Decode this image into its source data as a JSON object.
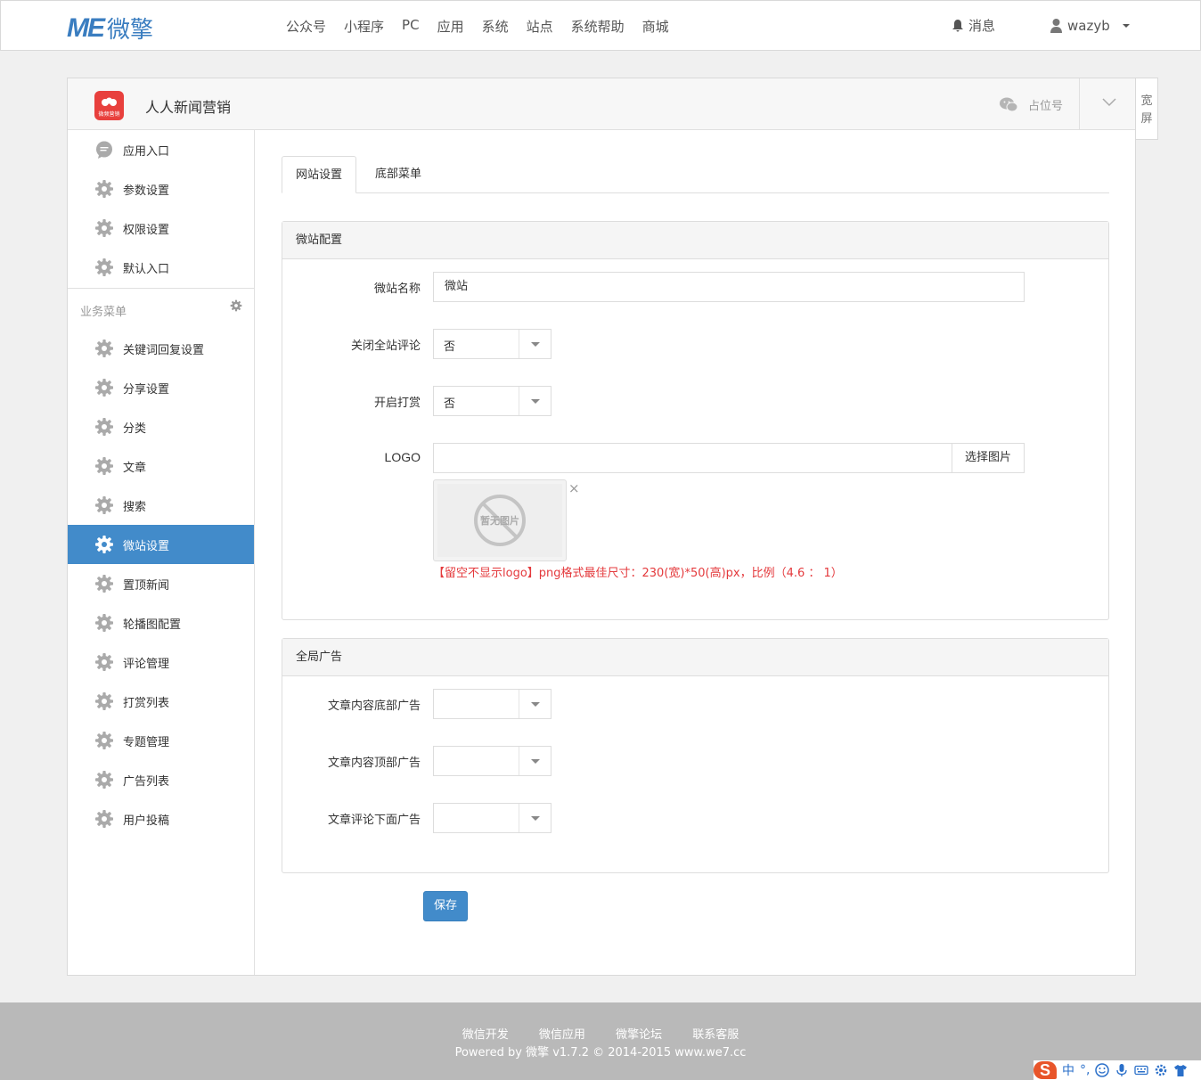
{
  "brand": {
    "logo_mark": "ME",
    "logo_text": "微擎"
  },
  "nav": [
    "公众号",
    "小程序",
    "PC",
    "应用",
    "系统",
    "站点",
    "系统帮助",
    "商城"
  ],
  "top_right": {
    "messages": "消息",
    "username": "wazyb"
  },
  "app": {
    "title": "人人新闻营销",
    "icon_text": "微频营销",
    "placeholder_account": "占位号",
    "accent": "#e8403d"
  },
  "wide_screen": {
    "line1": "宽",
    "line2": "屏"
  },
  "sidebar": {
    "top_items": [
      "应用入口",
      "参数设置",
      "权限设置",
      "默认入口"
    ],
    "group_label": "业务菜单",
    "items": [
      "关键词回复设置",
      "分享设置",
      "分类",
      "文章",
      "搜索",
      "微站设置",
      "置顶新闻",
      "轮播图配置",
      "评论管理",
      "打赏列表",
      "专题管理",
      "广告列表",
      "用户投稿"
    ],
    "active": "微站设置",
    "active_color": "#428bca"
  },
  "tabs": [
    "网站设置",
    "底部菜单"
  ],
  "site_config": {
    "title": "微站配置",
    "name_label": "微站名称",
    "name_value": "微站",
    "close_comments_label": "关闭全站评论",
    "close_comments_value": "否",
    "reward_label": "开启打赏",
    "reward_value": "否",
    "logo_label": "LOGO",
    "logo_value": "",
    "pick_image": "选择图片",
    "no_image": "暂无图片",
    "close_x": "×",
    "logo_hint": "【留空不显示logo】png格式最佳尺寸：230(宽)*50(高)px，比例（4.6 ： 1）"
  },
  "ads": {
    "title": "全局广告",
    "bottom_label": "文章内容底部广告",
    "top_label": "文章内容顶部广告",
    "comment_label": "文章评论下面广告",
    "bottom_value": "",
    "top_value": "",
    "comment_value": ""
  },
  "save_label": "保存",
  "footer": {
    "links": [
      "微信开发",
      "微信应用",
      "微擎论坛",
      "联系客服"
    ],
    "copyright": "Powered by 微擎 v1.7.2 © 2014-2015 www.we7.cc"
  },
  "ime": {
    "logo": "S",
    "lang": "中",
    "punct": "°,"
  }
}
